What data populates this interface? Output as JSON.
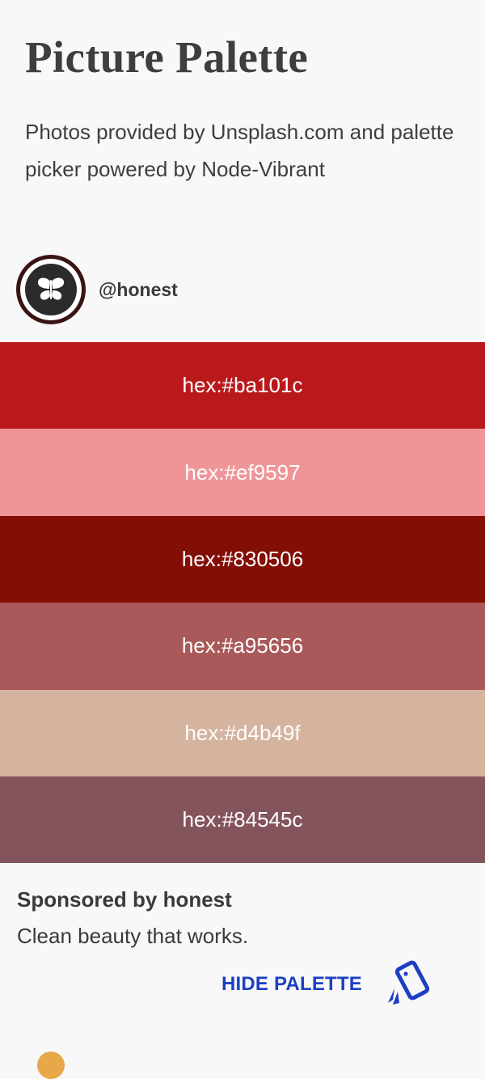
{
  "header": {
    "title": "Picture Palette",
    "subtitle": "Photos provided by Unsplash.com and palette picker powered by Node-Vibrant"
  },
  "author": {
    "handle": "@honest",
    "avatar_icon": "butterfly-logo-icon"
  },
  "palette": [
    {
      "label": "hex:#ba101c",
      "color": "#ba191c"
    },
    {
      "label": "hex:#ef9597",
      "color": "#ef9597"
    },
    {
      "label": "hex:#830506",
      "color": "#830e06"
    },
    {
      "label": "hex:#a95656",
      "color": "#a95959"
    },
    {
      "label": "hex:#d4b49f",
      "color": "#d4b49f"
    },
    {
      "label": "hex:#84545c",
      "color": "#84545c"
    }
  ],
  "sponsor": {
    "title": "Sponsored by honest",
    "text": "Clean beauty that works."
  },
  "actions": {
    "hide_palette_label": "HIDE PALETTE",
    "hide_palette_icon": "phone-cards-icon",
    "accent_color": "#1d3fc4"
  }
}
